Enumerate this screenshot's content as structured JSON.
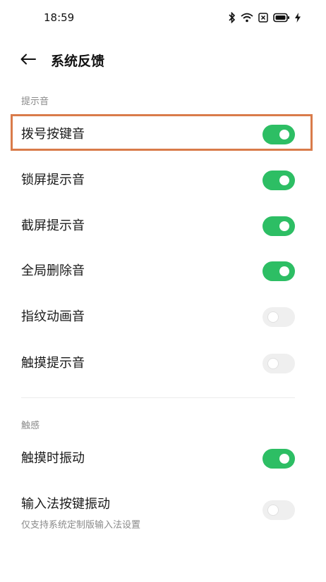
{
  "status_bar": {
    "time": "18:59",
    "icons": [
      "bluetooth-icon",
      "wifi-icon",
      "sim-off-icon",
      "battery-icon",
      "charging-icon"
    ]
  },
  "app_bar": {
    "title": "系统反馈"
  },
  "sections": [
    {
      "header": "提示音",
      "items": [
        {
          "label": "拨号按键音",
          "enabled": true,
          "highlighted": true
        },
        {
          "label": "锁屏提示音",
          "enabled": true
        },
        {
          "label": "截屏提示音",
          "enabled": true
        },
        {
          "label": "全局删除音",
          "enabled": true
        },
        {
          "label": "指纹动画音",
          "enabled": false
        },
        {
          "label": "触摸提示音",
          "enabled": false
        }
      ]
    },
    {
      "header": "触感",
      "items": [
        {
          "label": "触摸时振动",
          "enabled": true
        },
        {
          "label": "输入法按键振动",
          "sublabel": "仅支持系统定制版输入法设置",
          "enabled": false
        }
      ]
    }
  ],
  "colors": {
    "toggle_on": "#2dbe64",
    "toggle_off": "#efefef",
    "highlight": "#d97b4a"
  }
}
